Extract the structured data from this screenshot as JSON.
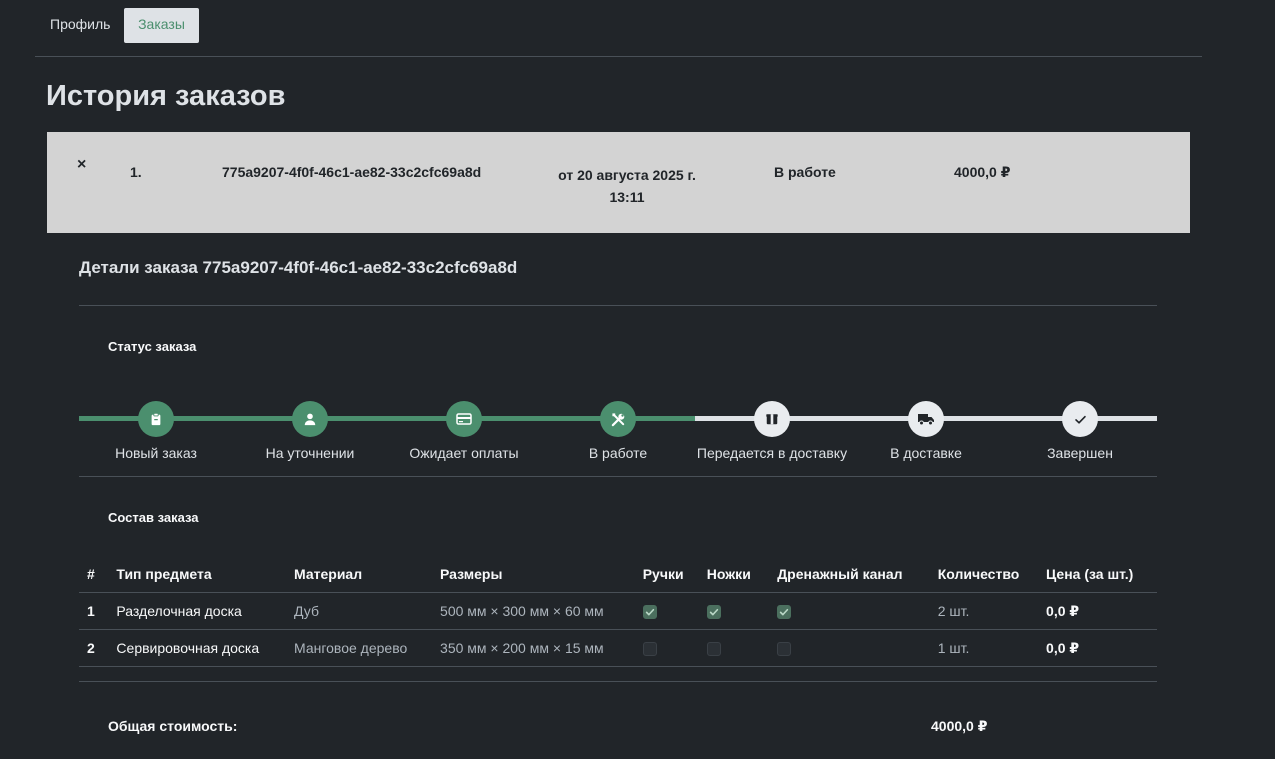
{
  "tabs": {
    "profile": "Профиль",
    "orders": "Заказы"
  },
  "page_title": "История заказов",
  "order": {
    "close": "×",
    "number": "1.",
    "id": "775a9207-4f0f-46c1-ae82-33c2cfc69a8d",
    "date_line1": "от 20 августа 2025 г.",
    "date_line2": "13:11",
    "status": "В работе",
    "total": "4000,0 ₽"
  },
  "details": {
    "title": "Детали заказа 775a9207-4f0f-46c1-ae82-33c2cfc69a8d",
    "status_heading": "Статус заказа",
    "steps": [
      {
        "label": "Новый заказ",
        "icon": "clipboard-icon",
        "done": true
      },
      {
        "label": "На уточнении",
        "icon": "user-icon",
        "done": true
      },
      {
        "label": "Ожидает оплаты",
        "icon": "credit-card-icon",
        "done": true
      },
      {
        "label": "В работе",
        "icon": "tools-icon",
        "done": true
      },
      {
        "label": "Передается в доставку",
        "icon": "box-icon",
        "done": false
      },
      {
        "label": "В доставке",
        "icon": "truck-icon",
        "done": false
      },
      {
        "label": "Завершен",
        "icon": "check-icon",
        "done": false
      }
    ],
    "composition_heading": "Состав заказа",
    "table": {
      "headers": [
        "#",
        "Тип предмета",
        "Материал",
        "Размеры",
        "Ручки",
        "Ножки",
        "Дренажный канал",
        "Количество",
        "Цена (за шт.)"
      ],
      "rows": [
        {
          "idx": "1",
          "type": "Разделочная доска",
          "material": "Дуб",
          "size": "500 мм × 300 мм × 60 мм",
          "handles": true,
          "legs": true,
          "drain": true,
          "qty": "2 шт.",
          "price": "0,0 ₽"
        },
        {
          "idx": "2",
          "type": "Сервировочная доска",
          "material": "Манговое дерево",
          "size": "350 мм × 200 мм × 15 мм",
          "handles": false,
          "legs": false,
          "drain": false,
          "qty": "1 шт.",
          "price": "0,0 ₽"
        }
      ]
    },
    "total_label": "Общая стоимость:",
    "total_value": "4000,0 ₽"
  },
  "colors": {
    "accent": "#4b8f6e",
    "background": "#212529",
    "row_bg": "#d3d3d3"
  }
}
